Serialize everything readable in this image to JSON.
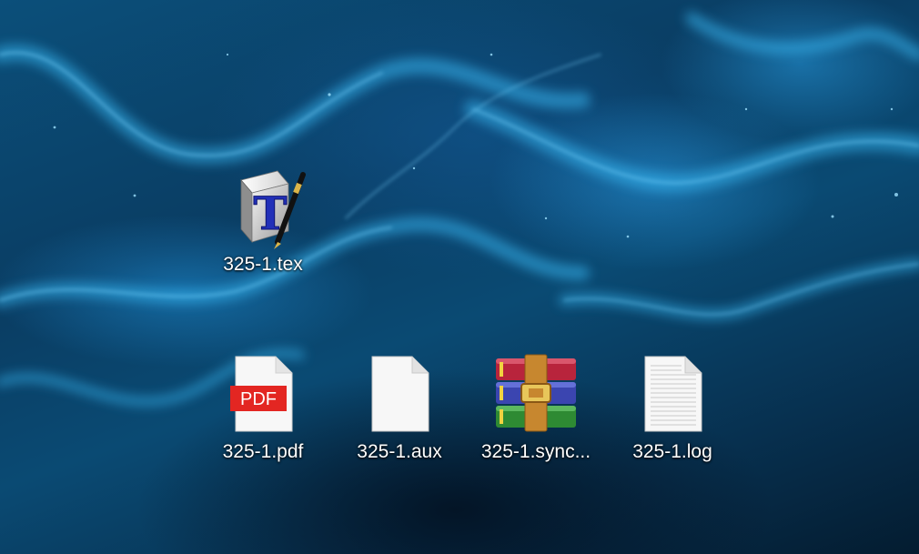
{
  "desktop": {
    "icons": [
      {
        "label": "325-1.tex",
        "icon": "texworks-icon"
      },
      {
        "label": "325-1.pdf",
        "icon": "pdf-file-icon",
        "badge": "PDF"
      },
      {
        "label": "325-1.aux",
        "icon": "blank-file-icon"
      },
      {
        "label": "325-1.sync...",
        "icon": "winrar-archive-icon"
      },
      {
        "label": "325-1.log",
        "icon": "text-file-icon"
      }
    ]
  },
  "colors": {
    "pdf_badge": "#e32622",
    "wallpaper_base": "#0a3d63",
    "wallpaper_glow": "#2fa8e8"
  }
}
